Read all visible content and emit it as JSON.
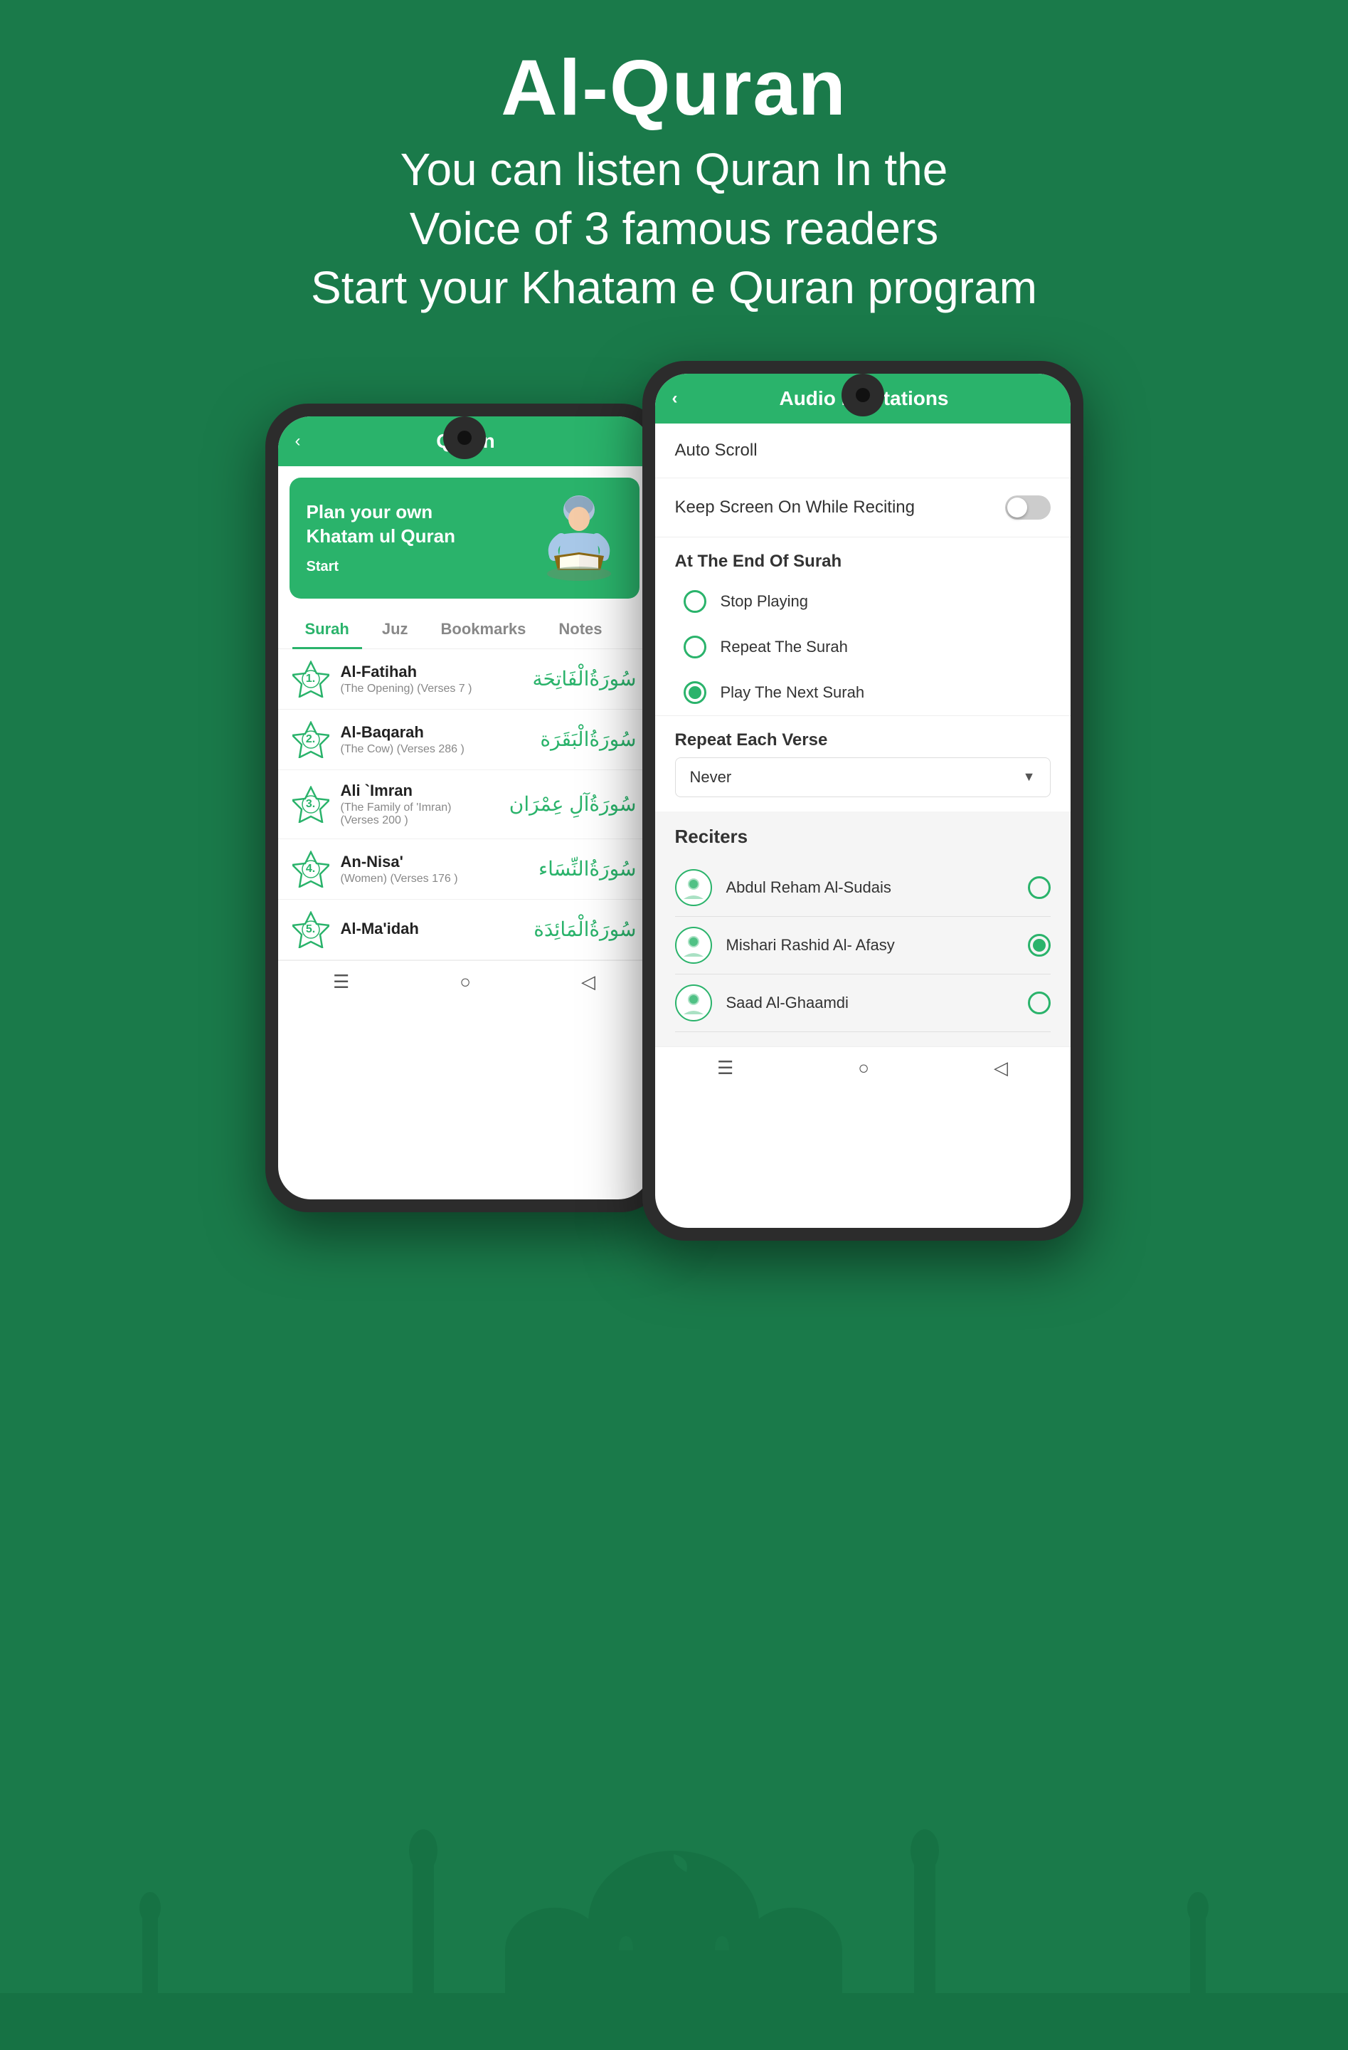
{
  "header": {
    "app_name": "Al-Quran",
    "subtitle_line1": "You can listen Quran In the",
    "subtitle_line2": "Voice of 3 famous readers",
    "subtitle_line3": "Start your Khatam e Quran program"
  },
  "phone_left": {
    "header": {
      "back_label": "‹",
      "title": "Quran"
    },
    "banner": {
      "title_line1": "Plan your own",
      "title_line2": "Khatam ul Quran",
      "start_label": "Start"
    },
    "tabs": [
      {
        "label": "Surah",
        "active": true
      },
      {
        "label": "Juz",
        "active": false
      },
      {
        "label": "Bookmarks",
        "active": false
      },
      {
        "label": "Notes",
        "active": false
      }
    ],
    "surahs": [
      {
        "number": "1.",
        "name": "Al-Fatihah",
        "sub": "(The Opening) (Verses 7 )",
        "arabic": "سُورَةُالْفَاتِحَة"
      },
      {
        "number": "2.",
        "name": "Al-Baqarah",
        "sub": "(The Cow) (Verses 286 )",
        "arabic": "سُورَةُالْبَقَرَة"
      },
      {
        "number": "3.",
        "name": "Ali `Imran",
        "sub": "(The Family of 'Imran)\n(Verses 200 )",
        "arabic": "سُورَةُآلِ عِمْرَان"
      },
      {
        "number": "4.",
        "name": "An-Nisa'",
        "sub": "(Women) (Verses 176 )",
        "arabic": "سُورَةُالنِّسَاء"
      },
      {
        "number": "5.",
        "name": "Al-Ma'idah",
        "sub": "",
        "arabic": "سُورَةُالْمَائِدَة"
      }
    ],
    "bottom_nav": {
      "icon1": "☰",
      "icon2": "○",
      "icon3": "◁"
    }
  },
  "phone_right": {
    "header": {
      "back_label": "‹",
      "title": "Audio Recitations"
    },
    "settings": {
      "auto_scroll_label": "Auto Scroll",
      "keep_screen_label": "Keep Screen On While Reciting",
      "keep_screen_toggle": false,
      "at_end_of_surah_label": "At The End Of Surah",
      "options": [
        {
          "label": "Stop Playing",
          "selected": false
        },
        {
          "label": "Repeat The Surah",
          "selected": false
        },
        {
          "label": "Play The Next Surah",
          "selected": true
        }
      ],
      "repeat_verse_label": "Repeat Each Verse",
      "repeat_verse_value": "Never",
      "reciters_label": "Reciters",
      "reciters": [
        {
          "name": "Abdul Reham Al-Sudais",
          "selected": false
        },
        {
          "name": "Mishari Rashid Al- Afasy",
          "selected": true
        },
        {
          "name": "Saad Al-Ghaamdi",
          "selected": false
        }
      ]
    },
    "bottom_nav": {
      "icon1": "☰",
      "icon2": "○",
      "icon3": "◁"
    }
  },
  "colors": {
    "primary": "#2ab36b",
    "dark_bg": "#1a7a4a",
    "text_white": "#ffffff",
    "text_dark": "#333333",
    "text_muted": "#888888"
  }
}
